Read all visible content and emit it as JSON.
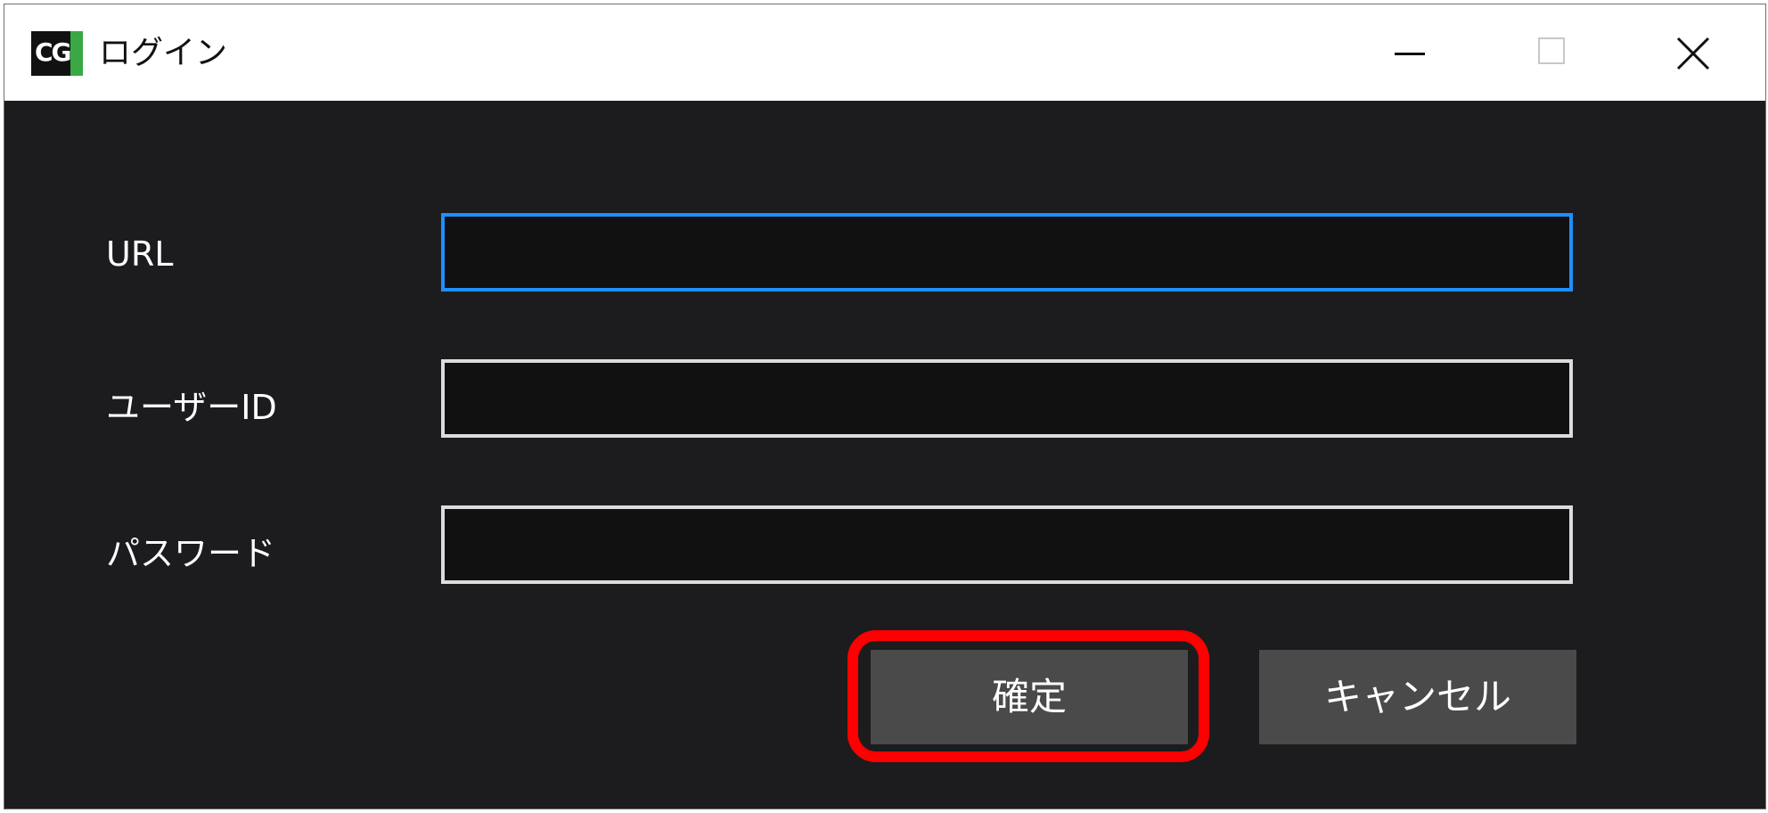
{
  "window": {
    "icon_text": "CG",
    "title": "ログイン",
    "controls": {
      "minimize": "minimize-icon",
      "maximize": "maximize-icon",
      "close": "close-icon"
    }
  },
  "form": {
    "fields": [
      {
        "label": "URL",
        "value": "",
        "placeholder": "",
        "focused": true
      },
      {
        "label": "ユーザーID",
        "value": "",
        "placeholder": ""
      },
      {
        "label": "パスワード",
        "value": "",
        "placeholder": ""
      }
    ],
    "buttons": {
      "confirm": "確定",
      "cancel": "キャンセル"
    }
  },
  "colors": {
    "background": "#1c1c1e",
    "field_background": "#111111",
    "field_border": "#dcdcdc",
    "focus_border": "#1f8fff",
    "button_background": "#4a4a4a",
    "highlight_annotation": "#ff0000",
    "app_icon_accent": "#3aa845"
  },
  "annotation": {
    "highlighted_element": "confirm-button"
  }
}
